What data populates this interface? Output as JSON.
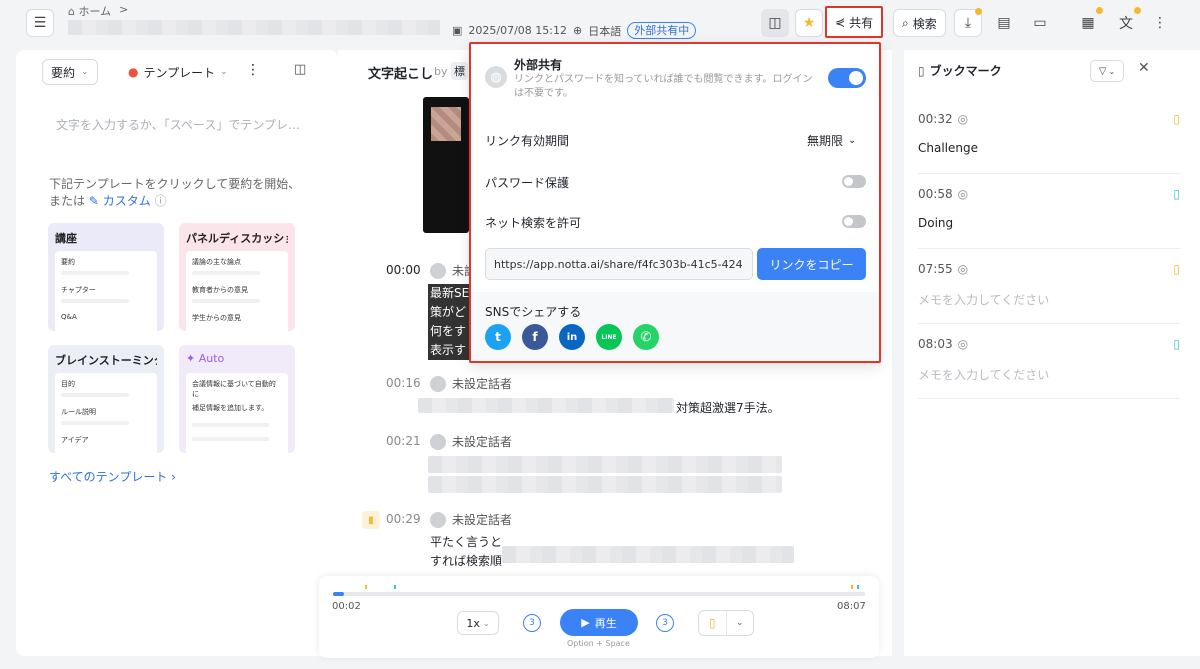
{
  "topbar": {
    "home": "ホーム",
    "separator": ">",
    "date": "2025/07/08 15:12",
    "language": "日本語",
    "share_status": "外部共有中",
    "share_label": "共有",
    "search_label": "検索"
  },
  "left": {
    "summary_dropdown": "要約",
    "template_dropdown": "テンプレート",
    "editor_placeholder": "文字を入力するか、「スペース」でテンプレ…",
    "hint_line1": "下記テンプレートをクリックして要約を開始、",
    "hint_line2": "または",
    "custom_link": "カスタム",
    "templates": [
      {
        "title": "講座",
        "rows": [
          "要約",
          "チャプター",
          "Q&A"
        ]
      },
      {
        "title": "パネルディスカッショ",
        "rows": [
          "議論の主な論点",
          "教育者からの意見",
          "学生からの意見"
        ]
      },
      {
        "title": "ブレインストーミンク",
        "rows": [
          "目的",
          "ルール説明",
          "アイデア"
        ]
      },
      {
        "title": "Auto",
        "rows": [
          "会議情報に基づいて自動的に",
          "補足情報を追加します。"
        ]
      }
    ],
    "all_templates": "すべてのテンプレート"
  },
  "middle": {
    "title": "文字起こし",
    "by": "by",
    "by_name": "標",
    "segments": [
      {
        "time": "00:00",
        "speaker": "未設",
        "lines": [
          "最新SE",
          "策がど",
          "何をす",
          "表示す"
        ]
      },
      {
        "time": "00:16",
        "speaker": "未設定話者",
        "text": "対策超激選7手法。"
      },
      {
        "time": "00:21",
        "speaker": "未設定話者"
      },
      {
        "time": "00:29",
        "speaker": "未設定話者",
        "lines": [
          "平たく言うと",
          "すれば検索順"
        ]
      }
    ]
  },
  "player": {
    "current": "00:02",
    "total": "08:07",
    "speed": "1x",
    "skip_back": "3",
    "play": "再生",
    "skip_fwd": "3",
    "shortcut": "Option + Space",
    "progress": 0.004
  },
  "bookmarks": {
    "title": "ブックマーク",
    "items": [
      {
        "time": "00:32",
        "text": "Challenge",
        "color": "#f5b82e"
      },
      {
        "time": "00:58",
        "text": "Doing",
        "color": "#3ec1d3"
      },
      {
        "time": "07:55",
        "placeholder": "メモを入力してください",
        "color": "#f5b82e"
      },
      {
        "time": "08:03",
        "placeholder": "メモを入力してください",
        "color": "#3ec1d3"
      }
    ]
  },
  "share_popup": {
    "title": "外部共有",
    "description_line1": "リンクとパスワードを知っていれば誰でも閲覧できます。ログイン",
    "description_line2": "は不要です。",
    "external_share_on": true,
    "expiry_label": "リンク有効期間",
    "expiry_value": "無期限",
    "password_label": "パスワード保護",
    "password_on": false,
    "search_label": "ネット検索を許可",
    "search_on": false,
    "url": "https://app.notta.ai/share/f4fc303b-41c5-424",
    "copy_label": "リンクをコピー",
    "sns_label": "SNSでシェアする",
    "sns": [
      {
        "name": "twitter",
        "color": "#1da1f2",
        "glyph": "t"
      },
      {
        "name": "facebook",
        "color": "#3b5998",
        "glyph": "f"
      },
      {
        "name": "linkedin",
        "color": "#0a66c2",
        "glyph": "in"
      },
      {
        "name": "line",
        "color": "#06c755",
        "glyph": "LINE"
      },
      {
        "name": "whatsapp",
        "color": "#25d366",
        "glyph": "✆"
      }
    ]
  },
  "colors": {
    "accent": "#3b82f6",
    "highlight_border": "#e0352b"
  }
}
